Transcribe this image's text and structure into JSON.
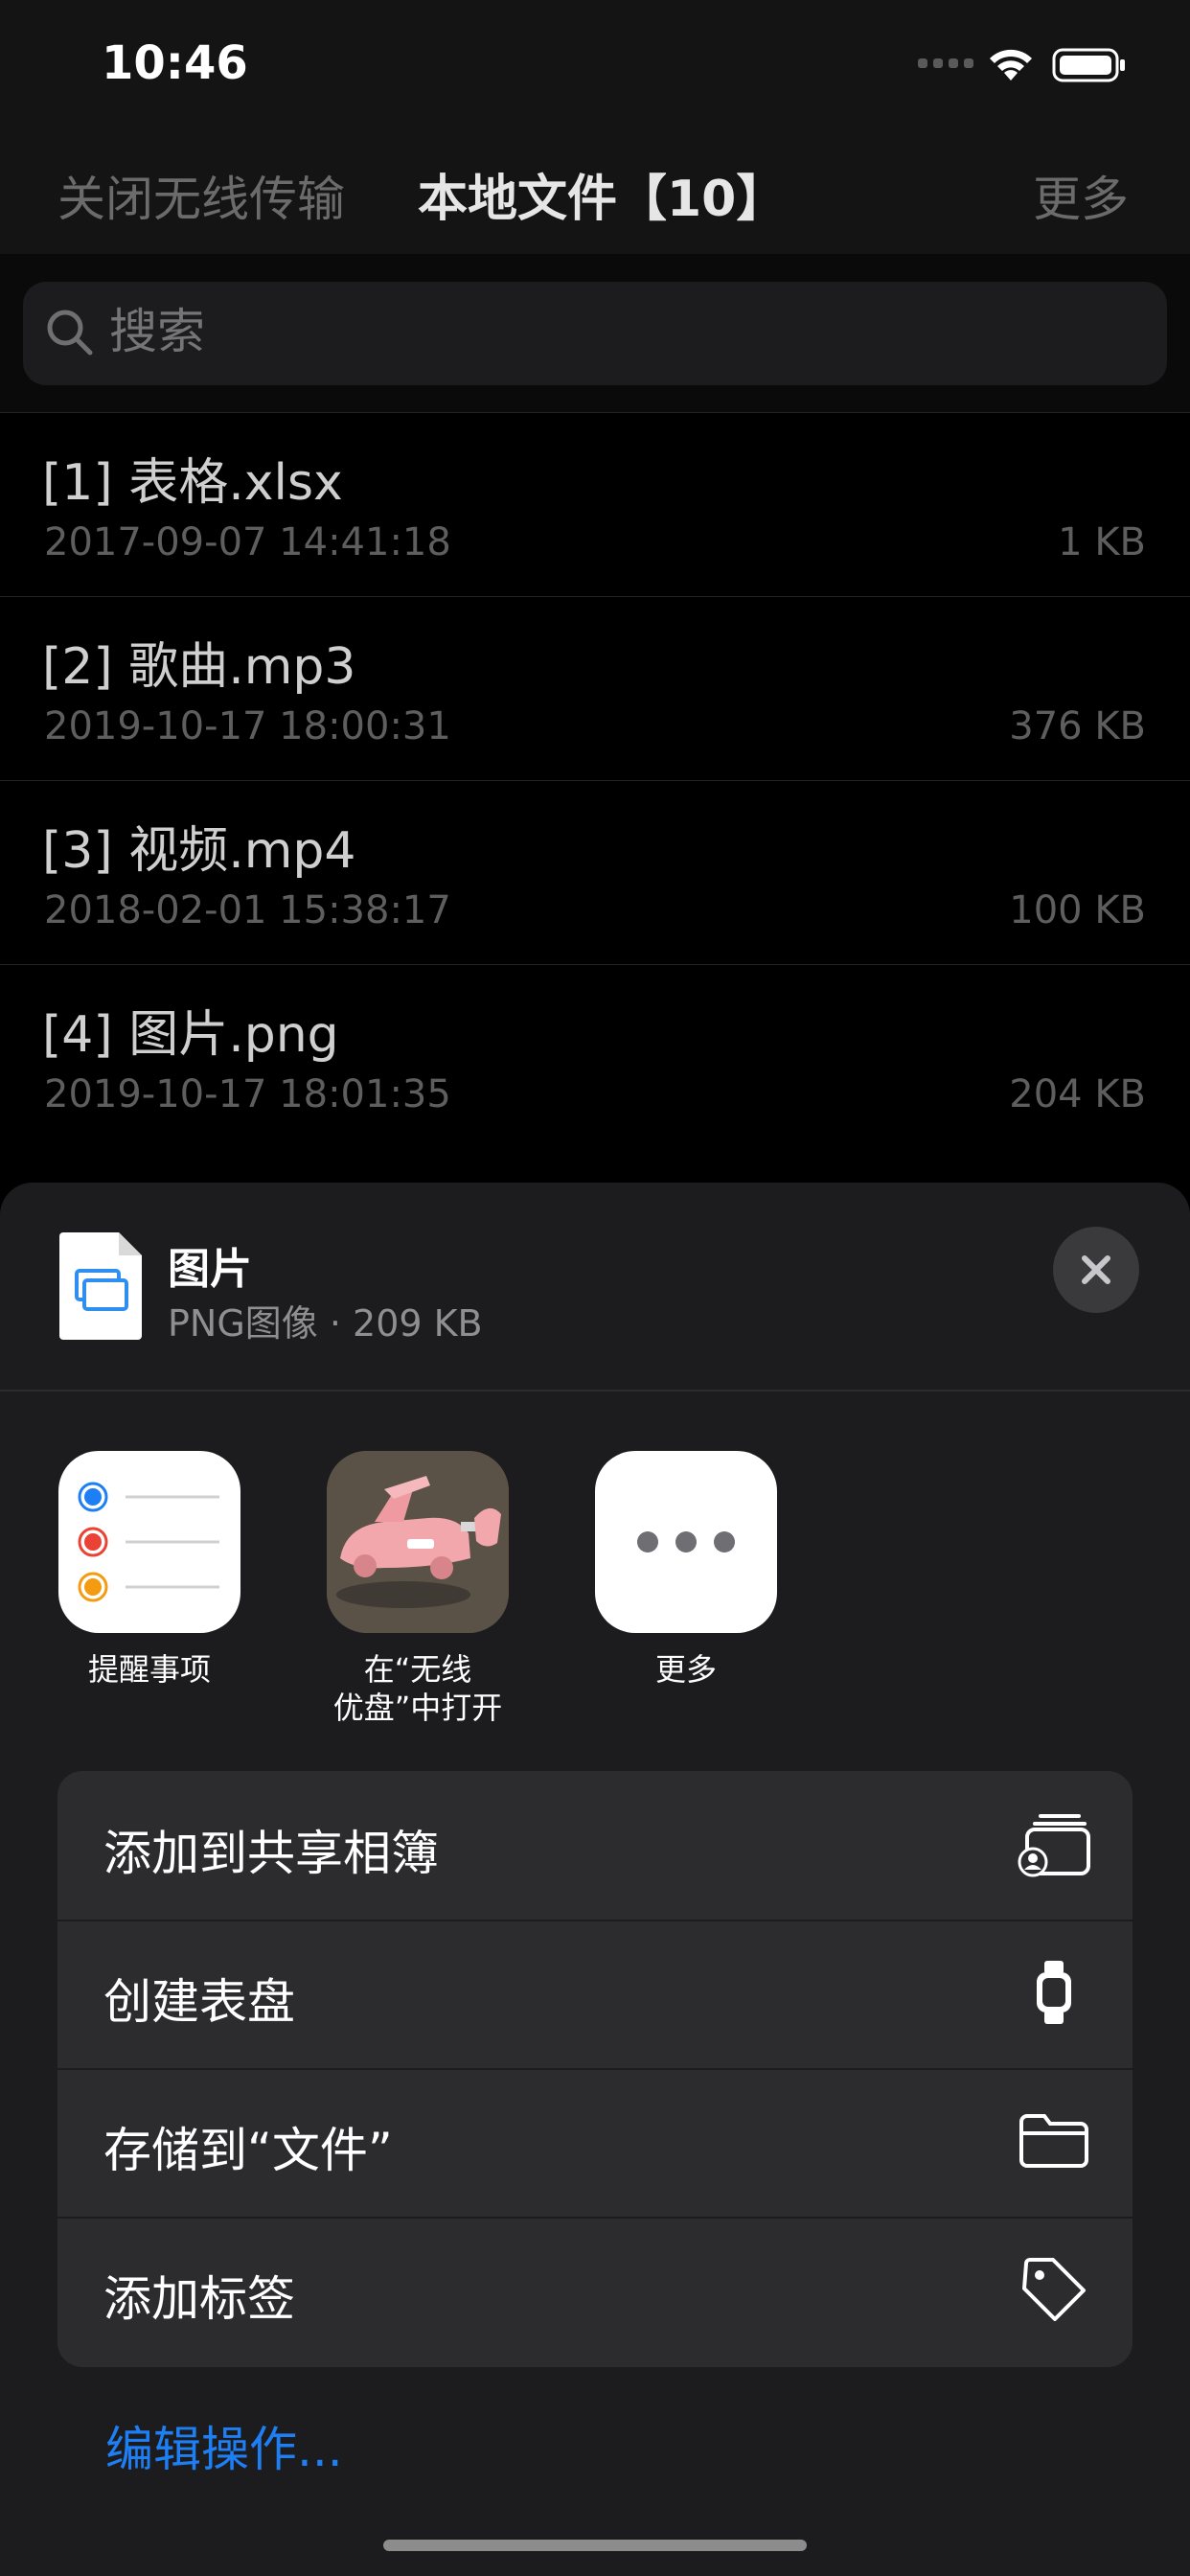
{
  "status_bar": {
    "time": "10:46"
  },
  "nav": {
    "left": "关闭无线传输",
    "title": "本地文件【10】",
    "right": "更多"
  },
  "search": {
    "placeholder": "搜索"
  },
  "files": [
    {
      "title": "[1] 表格.xlsx",
      "date": "2017-09-07 14:41:18",
      "size": "1 KB"
    },
    {
      "title": "[2] 歌曲.mp3",
      "date": "2019-10-17 18:00:31",
      "size": "376 KB"
    },
    {
      "title": "[3] 视频.mp4",
      "date": "2018-02-01 15:38:17",
      "size": "100 KB"
    },
    {
      "title": "[4] 图片.png",
      "date": "2019-10-17 18:01:35",
      "size": "204 KB"
    }
  ],
  "share_sheet": {
    "file_name": "图片",
    "file_meta": "PNG图像 · 209 KB",
    "apps": [
      {
        "label": "提醒事项",
        "icon": "reminders-icon"
      },
      {
        "label": "在“无线\n优盘”中打开",
        "icon": "app-thumbnail-icon"
      },
      {
        "label": "更多",
        "icon": "more-icon"
      }
    ],
    "actions": [
      {
        "label": "添加到共享相簿",
        "icon": "shared-album-icon"
      },
      {
        "label": "创建表盘",
        "icon": "watch-icon"
      },
      {
        "label": "存储到“文件”",
        "icon": "folder-icon"
      },
      {
        "label": "添加标签",
        "icon": "tag-icon"
      }
    ],
    "edit_actions": "编辑操作..."
  },
  "colors": {
    "accent": "#1e7ff5",
    "sheet_bg": "#1c1c1e",
    "action_bg": "#2c2c2e"
  }
}
